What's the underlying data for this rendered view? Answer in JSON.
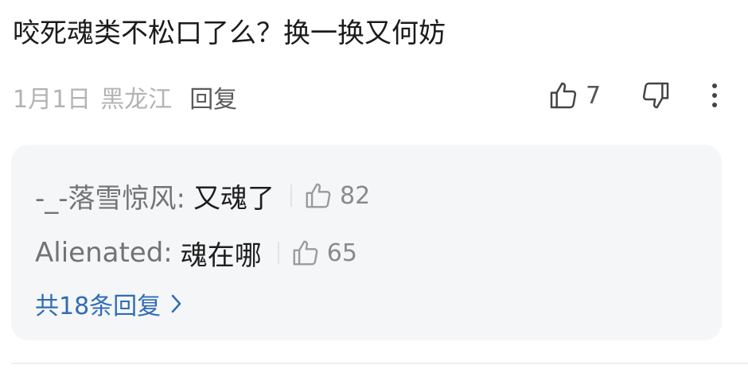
{
  "comment": {
    "text": "咬死魂类不松口了么？换一换又何妨",
    "date": "1月1日",
    "location": "黑龙江",
    "reply_label": "回复",
    "like_count": "7"
  },
  "replies": [
    {
      "user": "-_-落雪惊风:",
      "body": "又魂了",
      "likes": "82"
    },
    {
      "user": "Alienated:",
      "body": "魂在哪",
      "likes": "65"
    }
  ],
  "more_replies_label": "共18条回复",
  "colors": {
    "panel_bg": "#f5f6f8",
    "link": "#2f6db4",
    "meta": "#b3b3b3"
  },
  "icons": [
    "thumbs-up-icon",
    "thumbs-down-icon",
    "more-vertical-icon",
    "chevron-right-icon"
  ]
}
